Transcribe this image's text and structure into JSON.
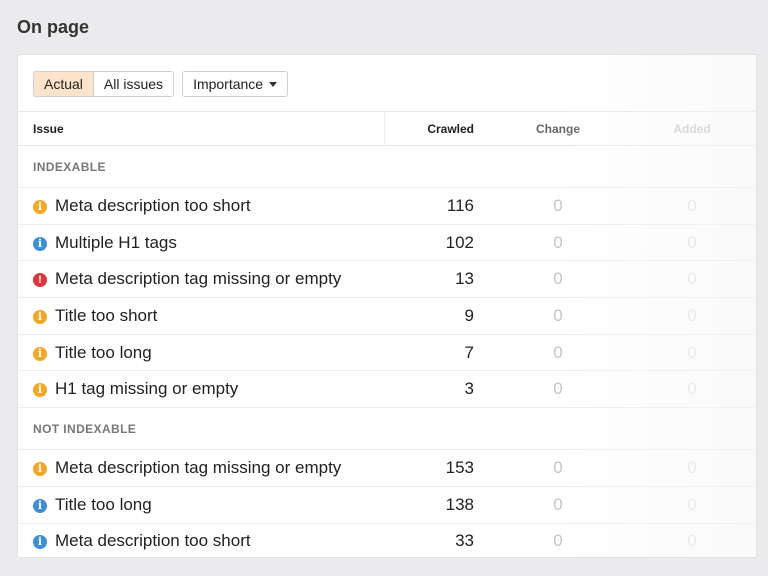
{
  "page": {
    "title": "On page"
  },
  "toolbar": {
    "tabs": [
      {
        "label": "Actual",
        "active": true
      },
      {
        "label": "All issues",
        "active": false
      }
    ],
    "sort_dropdown": {
      "label": "Importance"
    }
  },
  "table": {
    "headers": {
      "issue": "Issue",
      "crawled": "Crawled",
      "change": "Change",
      "added": "Added"
    },
    "groups": [
      {
        "label": "INDEXABLE",
        "rows": [
          {
            "icon": "warning-icon",
            "issue": "Meta description too short",
            "crawled": "116",
            "change": "0",
            "added": "0"
          },
          {
            "icon": "notice-icon",
            "issue": "Multiple H1 tags",
            "crawled": "102",
            "change": "0",
            "added": "0"
          },
          {
            "icon": "error-icon",
            "issue": "Meta description tag missing or empty",
            "crawled": "13",
            "change": "0",
            "added": "0"
          },
          {
            "icon": "warning-icon",
            "issue": "Title too short",
            "crawled": "9",
            "change": "0",
            "added": "0"
          },
          {
            "icon": "warning-icon",
            "issue": "Title too long",
            "crawled": "7",
            "change": "0",
            "added": "0"
          },
          {
            "icon": "warning-icon",
            "issue": "H1 tag missing or empty",
            "crawled": "3",
            "change": "0",
            "added": "0"
          }
        ]
      },
      {
        "label": "NOT INDEXABLE",
        "rows": [
          {
            "icon": "warning-icon",
            "issue": "Meta description tag missing or empty",
            "crawled": "153",
            "change": "0",
            "added": "0"
          },
          {
            "icon": "notice-icon",
            "issue": "Title too long",
            "crawled": "138",
            "change": "0",
            "added": "0"
          },
          {
            "icon": "notice-icon",
            "issue": "Meta description too short",
            "crawled": "33",
            "change": "0",
            "added": "0"
          }
        ]
      }
    ]
  },
  "colors": {
    "warning": "#f5a623",
    "notice": "#3b8fd9",
    "error": "#e0343c",
    "active_tab": "#fde3c9"
  }
}
